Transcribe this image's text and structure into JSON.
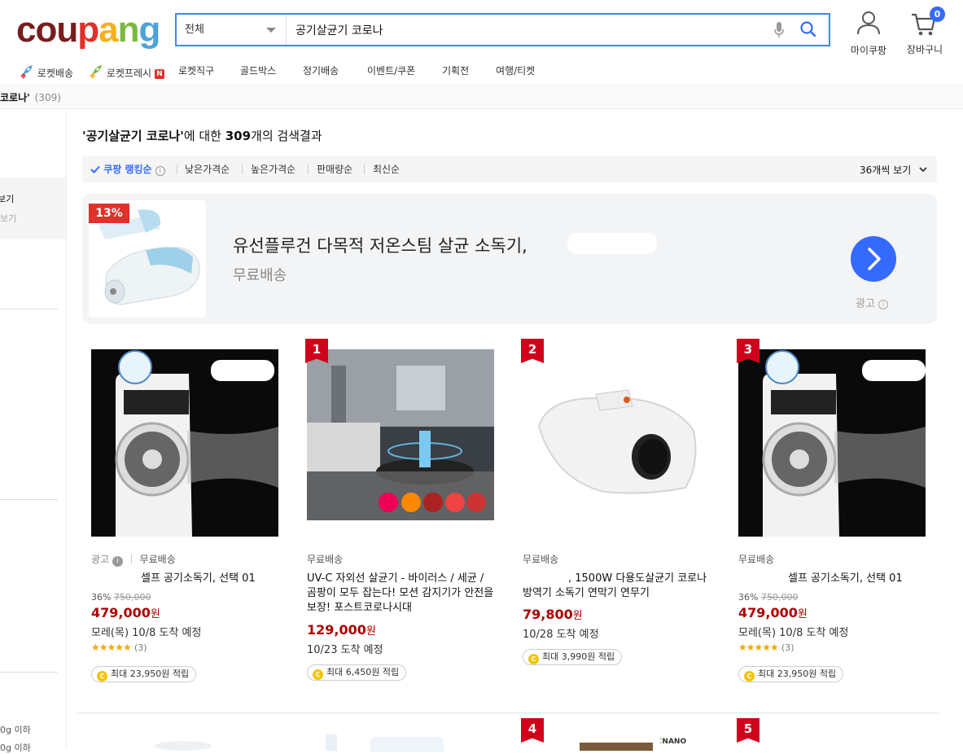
{
  "brand": {
    "letters": [
      "c",
      "o",
      "u",
      "p",
      "a",
      "n",
      "g"
    ],
    "colors": [
      "#781c1e",
      "#781c1e",
      "#781c1e",
      "#e0312a",
      "#f6b019",
      "#7ab940",
      "#4da3dc"
    ]
  },
  "search": {
    "category": "전체",
    "query": "공기살균기 코로나"
  },
  "header": {
    "mypage_label": "마이쿠팡",
    "cart_label": "장바구니",
    "cart_count": "0"
  },
  "nav": {
    "rocket_delivery": "로켓배송",
    "rocket_fresh": "로켓프레시",
    "new_badge": "N",
    "rocket_direct": "로켓직구",
    "goldbox": "골드박스",
    "subscription": "정기배송",
    "events": "이벤트/쿠폰",
    "plans": "기획전",
    "travel": "여행/티켓"
  },
  "breadcrumb": {
    "term": "코로나'",
    "count": "(309)"
  },
  "sidebar": {
    "item1": "보기",
    "item2": "보기",
    "item3": "0g 이하",
    "item4": "0g 이하"
  },
  "results": {
    "query_quoted": "'공기살균기 코로나'",
    "suffix_1": "에 대한 ",
    "count": "309",
    "suffix_2": "개의 검색결과"
  },
  "sort": {
    "ranking": "쿠팡 랭킹순",
    "low_price": "낮은가격순",
    "high_price": "높은가격순",
    "sales": "판매량순",
    "newest": "최신순",
    "per_page": "36개씩 보기"
  },
  "ad_banner": {
    "discount": "13%",
    "title": "유선플루건 다목적 저온스팀 살균 소독기,",
    "shipping": "무료배송",
    "ad_label": "광고"
  },
  "products": [
    {
      "rank": "",
      "ad_label": "광고",
      "shipping": "무료배송",
      "name": "셀프 공기소독기, 선택 01",
      "discount_rate": "36%",
      "original_price": "750,000",
      "price": "479,000",
      "currency": "원",
      "arrival": "모레(목) 10/8 도착 예정",
      "stars": "★★★★★",
      "review_count": "(3)",
      "reward": "최대 23,950원 적립"
    },
    {
      "rank": "1",
      "ad_label": "",
      "shipping": "무료배송",
      "name": "UV-C 자외선 살균기 - 바이러스 / 세균 / 곰팡이 모두 잡는다! 모션 감지기가 안전을 보장! 포스트코로나시대",
      "discount_rate": "",
      "original_price": "",
      "price": "129,000",
      "currency": "원",
      "arrival": "10/23 도착 예정",
      "stars": "",
      "review_count": "",
      "reward": "최대 6,450원 적립"
    },
    {
      "rank": "2",
      "ad_label": "",
      "shipping": "무료배송",
      "name": ", 1500W 다용도살균기 코로나 방역기 소독기 연막기 연무기",
      "discount_rate": "",
      "original_price": "",
      "price": "79,800",
      "currency": "원",
      "arrival": "10/28 도착 예정",
      "stars": "",
      "review_count": "",
      "reward": "최대 3,990원 적립"
    },
    {
      "rank": "3",
      "ad_label": "",
      "shipping": "무료배송",
      "name": "셀프 공기소독기, 선택 01",
      "discount_rate": "36%",
      "original_price": "750,000",
      "price": "479,000",
      "currency": "원",
      "arrival": "모레(목) 10/8 도착 예정",
      "stars": "★★★★★",
      "review_count": "(3)",
      "reward": "최대 23,950원 적립"
    }
  ],
  "next_row": {
    "rank_4": "4",
    "rank_5": "5",
    "nano_label": "NANO"
  },
  "colors": {
    "search_border": "#4285f4",
    "price_red": "#ae0000",
    "rank_red": "#d0021b",
    "accent_blue": "#346aff",
    "star": "#f7a600"
  }
}
